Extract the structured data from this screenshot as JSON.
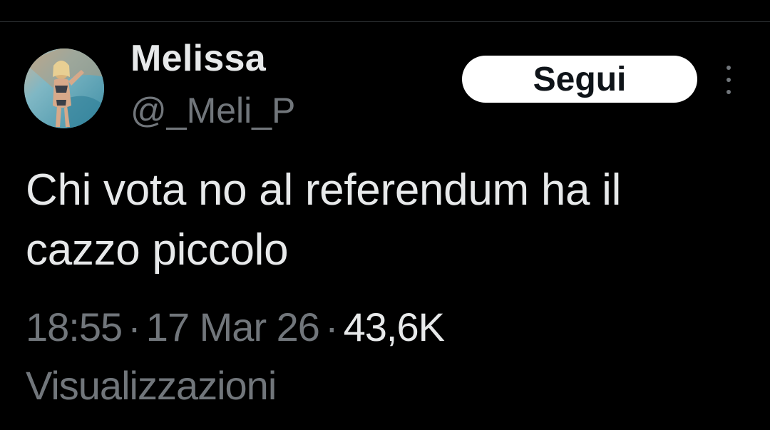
{
  "author": {
    "display_name": "Melissa",
    "handle": "@_Meli_P",
    "avatar_icon": "profile-photo"
  },
  "actions": {
    "follow_label": "Segui",
    "more_icon": "vertical-ellipsis-icon"
  },
  "tweet": {
    "line1": "Chi vota no al referendum ha il",
    "line2": "cazzo piccolo"
  },
  "meta": {
    "time": "18:55",
    "separator": "·",
    "date": "17 Mar 26",
    "views_count": "43,6K",
    "views_label": "Visualizzazioni"
  },
  "colors": {
    "background": "#000000",
    "primary_text": "#e7e9ea",
    "secondary_text": "#71767b",
    "button_bg": "#ffffff",
    "button_text": "#0f1419"
  }
}
